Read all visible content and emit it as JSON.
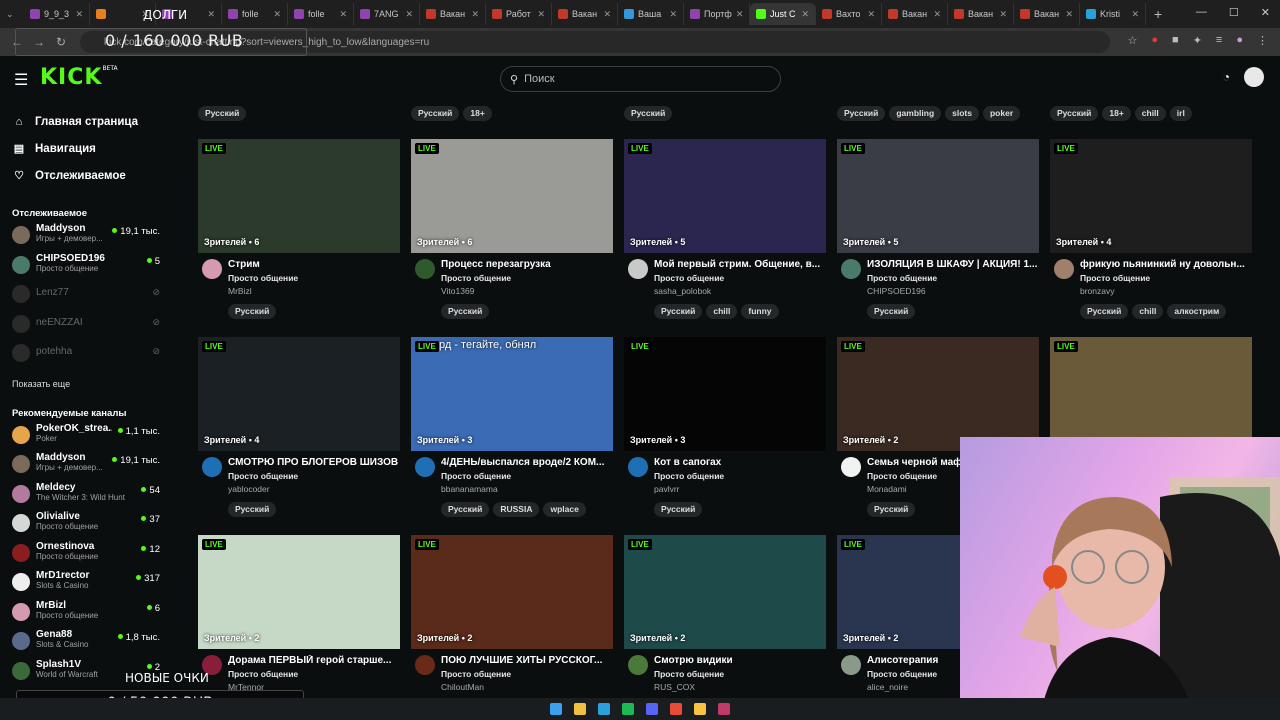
{
  "browser": {
    "tabs": [
      {
        "label": "9_9_3",
        "color": "#8e44ad"
      },
      {
        "label": "",
        "color": "#e67e22"
      },
      {
        "label": "",
        "color": "#8e44ad"
      },
      {
        "label": "folle",
        "color": "#8e44ad"
      },
      {
        "label": "folle",
        "color": "#8e44ad"
      },
      {
        "label": "7ANG",
        "color": "#8e44ad"
      },
      {
        "label": "Вакан",
        "color": "#c0392b"
      },
      {
        "label": "Работ",
        "color": "#c0392b"
      },
      {
        "label": "Вакан",
        "color": "#c0392b"
      },
      {
        "label": "Ваша",
        "color": "#3498db"
      },
      {
        "label": "Портф",
        "color": "#8e44ad"
      },
      {
        "label": "Just C",
        "color": "#53fc18",
        "active": true
      },
      {
        "label": "Вахто",
        "color": "#c0392b"
      },
      {
        "label": "Вакан",
        "color": "#c0392b"
      },
      {
        "label": "Вакан",
        "color": "#c0392b"
      },
      {
        "label": "Вакан",
        "color": "#c0392b"
      },
      {
        "label": "Kristi",
        "color": "#2aa1da"
      }
    ],
    "url": "kick.com/category/just-chatting?sort=viewers_high_to_low&languages=ru"
  },
  "overlay": {
    "donate_label": "ДОЛГИ",
    "donate_goal": "0 / 160 000 RUB",
    "glasses_label": "НОВЫЕ ОЧКИ",
    "glasses_goal": "0 / 50 000 RUB"
  },
  "header": {
    "logo": "KICK",
    "logo_badge": "BETA",
    "search_placeholder": "Поиск"
  },
  "sidebar": {
    "nav": [
      {
        "label": "Главная страница",
        "icon": "home-icon",
        "glyph": "⌂"
      },
      {
        "label": "Навигация",
        "icon": "browse-icon",
        "glyph": "▤"
      },
      {
        "label": "Отслеживаемое",
        "icon": "heart-icon",
        "glyph": "♡"
      }
    ],
    "following_title": "Отслеживаемое",
    "following": [
      {
        "name": "Maddyson",
        "category": "Игры + демовер...",
        "viewers": "19,1 тыс.",
        "color": "#7a6a5a"
      },
      {
        "name": "CHIPSOED196",
        "category": "Просто общение",
        "viewers": "5",
        "color": "#4a7a6a"
      }
    ],
    "offline": [
      "Lenz77",
      "neENZZAI",
      "potehha"
    ],
    "show_more": "Показать еще",
    "recommended_title": "Рекомендуемые каналы",
    "recommended": [
      {
        "name": "PokerOK_strea...",
        "category": "Poker",
        "viewers": "1,1 тыс.",
        "color": "#e5a54b"
      },
      {
        "name": "Maddyson",
        "category": "Игры + демовер...",
        "viewers": "19,1 тыс.",
        "color": "#7a6a5a"
      },
      {
        "name": "Meldecy",
        "category": "The Witcher 3: Wild Hunt",
        "viewers": "54",
        "color": "#b37aa0"
      },
      {
        "name": "Olivialive",
        "category": "Просто общение",
        "viewers": "37",
        "color": "#d6d6d6"
      },
      {
        "name": "Ornestinova",
        "category": "Просто общение",
        "viewers": "12",
        "color": "#8a1e1e"
      },
      {
        "name": "MrD1rector",
        "category": "Slots & Casino",
        "viewers": "317",
        "color": "#eeeeee"
      },
      {
        "name": "MrBizl",
        "category": "Просто общение",
        "viewers": "6",
        "color": "#d69ab0"
      },
      {
        "name": "Gena88",
        "category": "Slots & Casino",
        "viewers": "1,8 тыс.",
        "color": "#5a6a8a"
      },
      {
        "name": "Splash1V",
        "category": "World of Warcraft",
        "viewers": "2",
        "color": "#3a6a3a"
      }
    ]
  },
  "top_row_tags": [
    [
      "Русский"
    ],
    [
      "Русский",
      "18+"
    ],
    [
      "Русский"
    ],
    [
      "Русский",
      "gambling",
      "slots",
      "poker"
    ],
    [
      "Русский",
      "18+",
      "chill",
      "irl"
    ]
  ],
  "streams": [
    {
      "live": "LIVE",
      "viewers": "Зрителей • 6",
      "title": "Стрим",
      "category": "Просто общение",
      "user": "MrBizl",
      "tags": [
        "Русский"
      ],
      "thumb": "#2b3a2a",
      "avatar": "#d69ab0"
    },
    {
      "live": "LIVE",
      "viewers": "Зрителей • 6",
      "title": "Процесс перезагрузка",
      "category": "Просто общение",
      "user": "Vito1369",
      "tags": [
        "Русский"
      ],
      "thumb": "#9a9a96",
      "avatar": "#2e5a2e"
    },
    {
      "live": "LIVE",
      "viewers": "Зрителей • 5",
      "title": "Мой первый стрим. Общение, в...",
      "category": "Просто общение",
      "user": "sasha_polobok",
      "tags": [
        "Русский",
        "chill",
        "funny"
      ],
      "thumb": "#2a2650",
      "avatar": "#c9c9c9"
    },
    {
      "live": "LIVE",
      "viewers": "Зрителей • 5",
      "title": "ИЗОЛЯЦИЯ В ШКАФУ | АКЦИЯ! 1...",
      "category": "Просто общение",
      "user": "CHIPSOED196",
      "tags": [
        "Русский"
      ],
      "thumb": "#3a3d45",
      "avatar": "#4a7a6a"
    },
    {
      "live": "LIVE",
      "viewers": "Зрителей • 4",
      "title": "фрикую пьянинкий ну довольн...",
      "category": "Просто общение",
      "user": "bronzavy",
      "tags": [
        "Русский",
        "chill",
        "алкострим"
      ],
      "thumb": "#1e1e1e",
      "avatar": "#a0806a"
    },
    {
      "live": "LIVE",
      "viewers": "Зрителей • 4",
      "title": "СМОТРЮ ПРО БЛОГЕРОВ ШИЗОВ",
      "category": "Просто общение",
      "user": "yablocoder",
      "tags": [
        "Русский"
      ],
      "thumb": "#1b2024",
      "avatar": "#1f6fb5"
    },
    {
      "live": "LIVE",
      "viewers": "Зрителей • 3",
      "title": "4/ДЕНЬ/выспался вроде/2 КОМ...",
      "category": "Просто общение",
      "user": "bbananamama",
      "tags": [
        "Русский",
        "RUSSIA",
        "wplace"
      ],
      "thumb": "#3b6bb5",
      "avatar": "#1f6fb5",
      "overlay_text": "рд - тегайте, обнял"
    },
    {
      "live": "LIVE",
      "viewers": "Зрителей • 3",
      "title": "Кот в сапогах",
      "category": "Просто общение",
      "user": "pavlvrr",
      "tags": [
        "Русский"
      ],
      "thumb": "#050505",
      "avatar": "#1f6fb5"
    },
    {
      "live": "LIVE",
      "viewers": "Зрителей • 2",
      "title": "Семья черной мафи...",
      "category": "Просто общение",
      "user": "Monadami",
      "tags": [
        "Русский"
      ],
      "thumb": "#3a2a22",
      "avatar": "#f2f2f2"
    },
    {
      "live": "LIVE",
      "viewers": "",
      "title": "",
      "category": "",
      "user": "",
      "tags": [],
      "thumb": "#6a5a3a",
      "avatar": "#6a5a3a"
    },
    {
      "live": "LIVE",
      "viewers": "Зрителей • 2",
      "title": "Дорама ПЕРВЫЙ герой старше...",
      "category": "Просто общение",
      "user": "MrTennor",
      "tags": [],
      "thumb": "#c6d8c6",
      "avatar": "#8a1e3a"
    },
    {
      "live": "LIVE",
      "viewers": "Зрителей • 2",
      "title": "ПОЮ ЛУЧШИЕ ХИТЫ РУССКОГ...",
      "category": "Просто общение",
      "user": "ChiloutMan",
      "tags": [],
      "thumb": "#5a2a1a",
      "avatar": "#6a2a1a"
    },
    {
      "live": "LIVE",
      "viewers": "Зрителей • 2",
      "title": "Смотрю видики",
      "category": "Просто общение",
      "user": "RUS_COX",
      "tags": [],
      "thumb": "#1e4a4a",
      "avatar": "#4a7a3a"
    },
    {
      "live": "LIVE",
      "viewers": "Зрителей • 2",
      "title": "Алисотерапия",
      "category": "Просто общение",
      "user": "alice_noire",
      "tags": [],
      "thumb": "#2a3550",
      "avatar": "#8a9a8a"
    }
  ],
  "taskbar": [
    "#3aa0f0",
    "#f0c040",
    "#2aa1da",
    "#1db954",
    "#5865f2",
    "#e84b3a",
    "#f6c343",
    "#c23a6a"
  ]
}
